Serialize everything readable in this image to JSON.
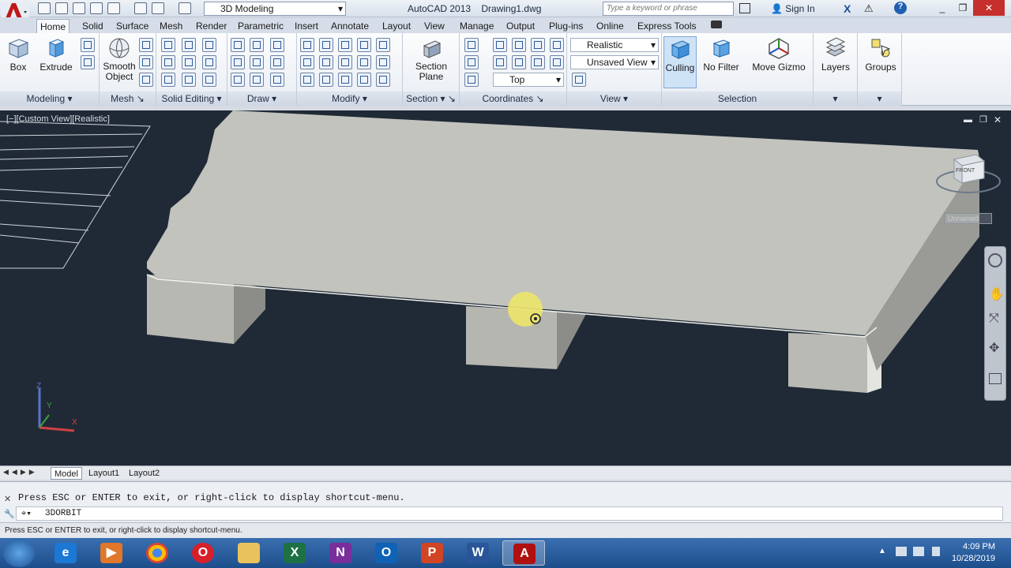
{
  "titlebar": {
    "workspace": "3D Modeling",
    "title": "AutoCAD 2013    Drawing1.dwg",
    "search_placeholder": "Type a keyword or phrase",
    "sign_in": "Sign In"
  },
  "tabs": [
    "Home",
    "Solid",
    "Surface",
    "Mesh",
    "Render",
    "Parametric",
    "Insert",
    "Annotate",
    "Layout",
    "View",
    "Manage",
    "Output",
    "Plug-ins",
    "Online",
    "Express Tools"
  ],
  "ribbon": {
    "box_label": "Box",
    "extrude_label": "Extrude",
    "smooth_label_1": "Smooth",
    "smooth_label_2": "Object",
    "section_label_1": "Section",
    "section_label_2": "Plane",
    "visual_style": "Realistic",
    "view_combo": "Unsaved View",
    "view_top": "Top",
    "culling_label": "Culling",
    "nofilter_label": "No Filter",
    "gizmo_label": "Move Gizmo",
    "layers_label": "Layers",
    "groups_label": "Groups",
    "panels": {
      "modeling": "Modeling",
      "mesh": "Mesh",
      "solid_editing": "Solid Editing",
      "draw": "Draw",
      "modify": "Modify",
      "section": "Section",
      "coordinates": "Coordinates",
      "view": "View",
      "selection": "Selection"
    }
  },
  "viewport": {
    "label": "[−][Custom View][Realistic]",
    "viewcube_face": "FRONT",
    "ucs_label": "Unnamed",
    "axis_z": "Z",
    "axis_y": "Y",
    "axis_x": "X"
  },
  "layout_tabs": [
    "Model",
    "Layout1",
    "Layout2"
  ],
  "command": {
    "history": "Press ESC or ENTER to exit, or right-click to display shortcut-menu.",
    "input": "3DORBIT"
  },
  "status_text": "Press ESC or ENTER to exit, or right-click to display shortcut-menu.",
  "clock": {
    "time": "4:09 PM",
    "date": "10/28/2019"
  }
}
